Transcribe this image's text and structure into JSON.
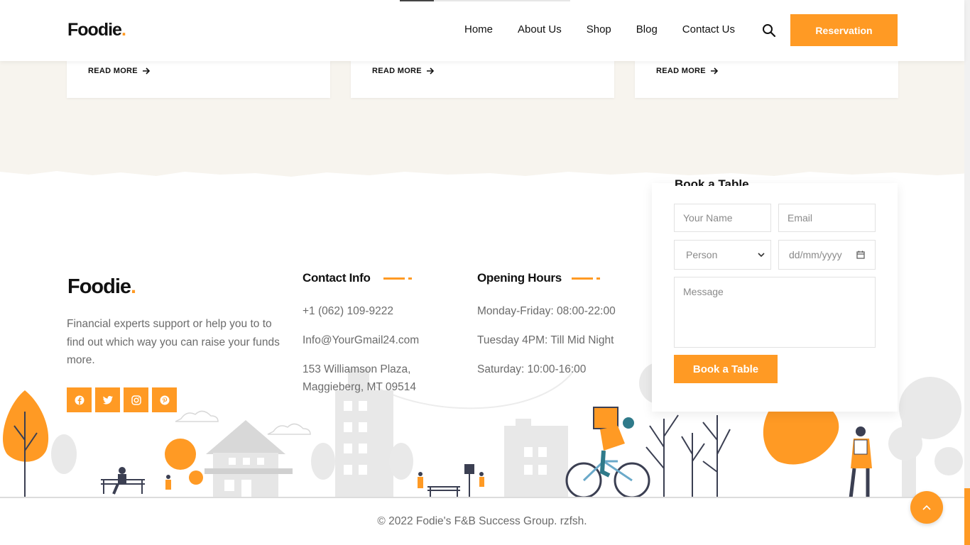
{
  "header": {
    "logo": "Foodie",
    "logo_dot": ".",
    "nav": [
      "Home",
      "About Us",
      "Shop",
      "Blog",
      "Contact Us"
    ],
    "reservation_label": "Reservation"
  },
  "cards": [
    {
      "read_more": "READ MORE"
    },
    {
      "read_more": "READ MORE"
    },
    {
      "read_more": "READ MORE"
    }
  ],
  "footer": {
    "logo": "Foodie",
    "logo_dot": ".",
    "about": "Financial experts support or help you to to find out which way you can raise your funds more.",
    "social": [
      "facebook-icon",
      "twitter-icon",
      "instagram-icon",
      "pinterest-icon"
    ],
    "contact": {
      "title": "Contact Info",
      "phone": "+1 (062) 109-9222",
      "email": "Info@YourGmail24.com",
      "address_line1": "153 Williamson Plaza,",
      "address_line2": "Maggieberg, MT 09514"
    },
    "hours": {
      "title": "Opening Hours",
      "line1": "Monday-Friday: 08:00-22:00",
      "line2": "Tuesday 4PM: Till Mid Night",
      "line3": "Saturday: 10:00-16:00"
    },
    "copyright": "© 2022 Fodie's F&B Success Group. rzfsh."
  },
  "booking": {
    "title": "Book a Table",
    "name_placeholder": "Your Name",
    "email_placeholder": "Email",
    "person_value": "Person",
    "date_value": "dd/mm/yyyy",
    "message_placeholder": "Message",
    "submit_label": "Book a Table"
  },
  "colors": {
    "accent": "#ff9a24",
    "beige": "#f7f4ee",
    "text_muted": "#6b6b6b"
  }
}
